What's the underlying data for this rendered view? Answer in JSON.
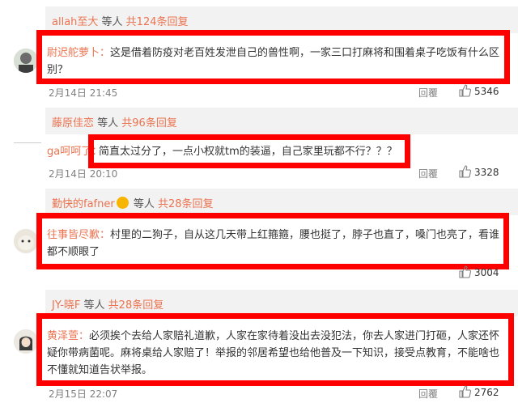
{
  "threads": [
    {
      "top": {
        "user": "allah至大",
        "others": " 等人 ",
        "count": "共124条回复"
      },
      "comment_user": "尉迟舵萝卜：",
      "comment_text": "这是借着防疫对老百姓发泄自己的兽性啊，一家三口打麻将和围着桌子吃饭有什么区别？",
      "date": "2月14日 21:45",
      "reply": "回覆",
      "likes": "5346"
    },
    {
      "top": {
        "user": "藤原佳恋",
        "others": " 等人 ",
        "count": "共96条回复"
      },
      "comment_user": "ga呵呵了：",
      "comment_text": "简直太过分了，一点小权就tm的装逼，自己家里玩都不行？？？",
      "date": "2月14日 20:10",
      "reply": "回覆",
      "likes": "3328"
    },
    {
      "top": {
        "user": "勤快的fafner",
        "others": " 等人 ",
        "count": "共28条回复"
      },
      "comment_user": "往事皆尽歉：",
      "comment_text": "村里的二狗子，自从这几天带上红箍箍，腰也挺了，脖子也直了，嗓门也亮了，看谁都不顺眼了",
      "date": "",
      "reply": "",
      "likes": "3004"
    },
    {
      "top": {
        "user": "JY-晓F",
        "others": " 等人 ",
        "count": "共28条回复"
      },
      "comment_user": "黄泽萱：",
      "comment_text": "必须挨个去给人家赔礼道歉，人家在家待着没出去没犯法，你去人家进门打砸，人家还怀疑你带病菌呢。麻将桌给人家赔了！举报的邻居希望也给他普及一下知识，接受点教育，不能啥也不懂就知道告状举报。",
      "date": "2月15日 22:07",
      "reply": "回覆",
      "likes": "2762"
    }
  ],
  "icons": {
    "thumb": "thumbs-up-icon",
    "avatar": "user-avatar",
    "emoji": "smiley-icon"
  },
  "colors": {
    "link": "#eb7350",
    "highlight": "#ff0000",
    "subbar": "#f2f2f2"
  }
}
